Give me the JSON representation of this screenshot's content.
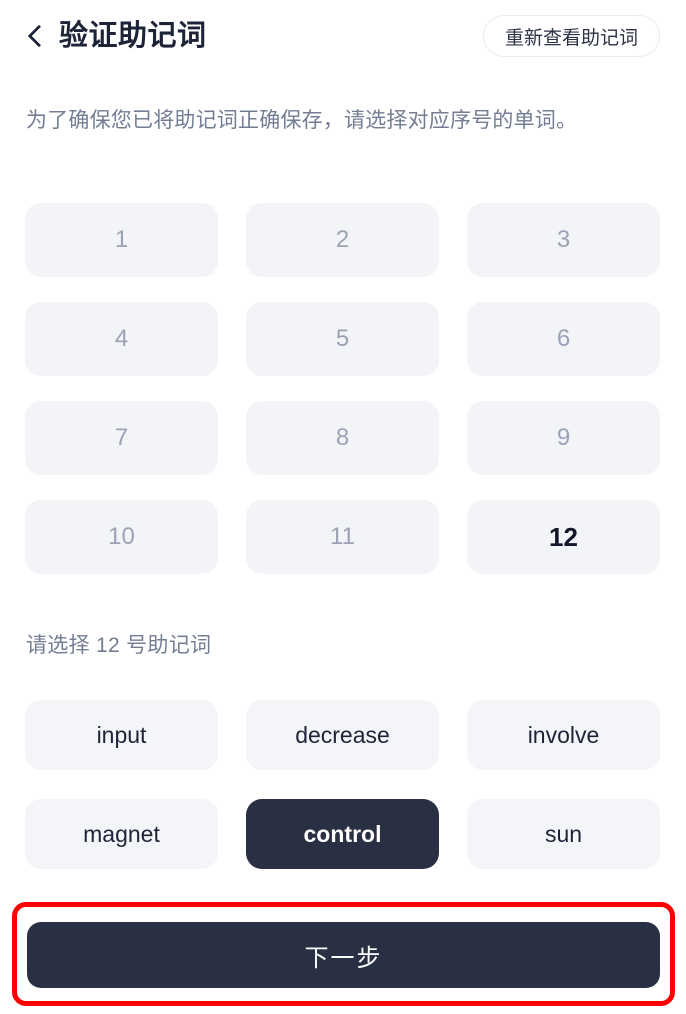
{
  "header": {
    "back_icon": "chevron-left-icon",
    "title": "验证助记词",
    "action_button": "重新查看助记词"
  },
  "description": "为了确保您已将助记词正确保存，请选择对应序号的单词。",
  "number_grid": {
    "active_index": 12,
    "items": [
      {
        "label": "1",
        "active": false
      },
      {
        "label": "2",
        "active": false
      },
      {
        "label": "3",
        "active": false
      },
      {
        "label": "4",
        "active": false
      },
      {
        "label": "5",
        "active": false
      },
      {
        "label": "6",
        "active": false
      },
      {
        "label": "7",
        "active": false
      },
      {
        "label": "8",
        "active": false
      },
      {
        "label": "9",
        "active": false
      },
      {
        "label": "10",
        "active": false
      },
      {
        "label": "11",
        "active": false
      },
      {
        "label": "12",
        "active": true
      }
    ]
  },
  "select_prompt": "请选择 12 号助记词",
  "word_grid": {
    "selected_word": "control",
    "items": [
      {
        "label": "input",
        "selected": false
      },
      {
        "label": "decrease",
        "selected": false
      },
      {
        "label": "involve",
        "selected": false
      },
      {
        "label": "magnet",
        "selected": false
      },
      {
        "label": "control",
        "selected": true
      },
      {
        "label": "sun",
        "selected": false
      }
    ]
  },
  "footer": {
    "next_button": "下一步"
  },
  "colors": {
    "accent_dark": "#2a3043",
    "tile_bg": "#f3f4f8",
    "muted_text": "#737d93",
    "number_text": "#9aa2b5",
    "annotation": "#ff0000",
    "background": "#ffffff"
  }
}
